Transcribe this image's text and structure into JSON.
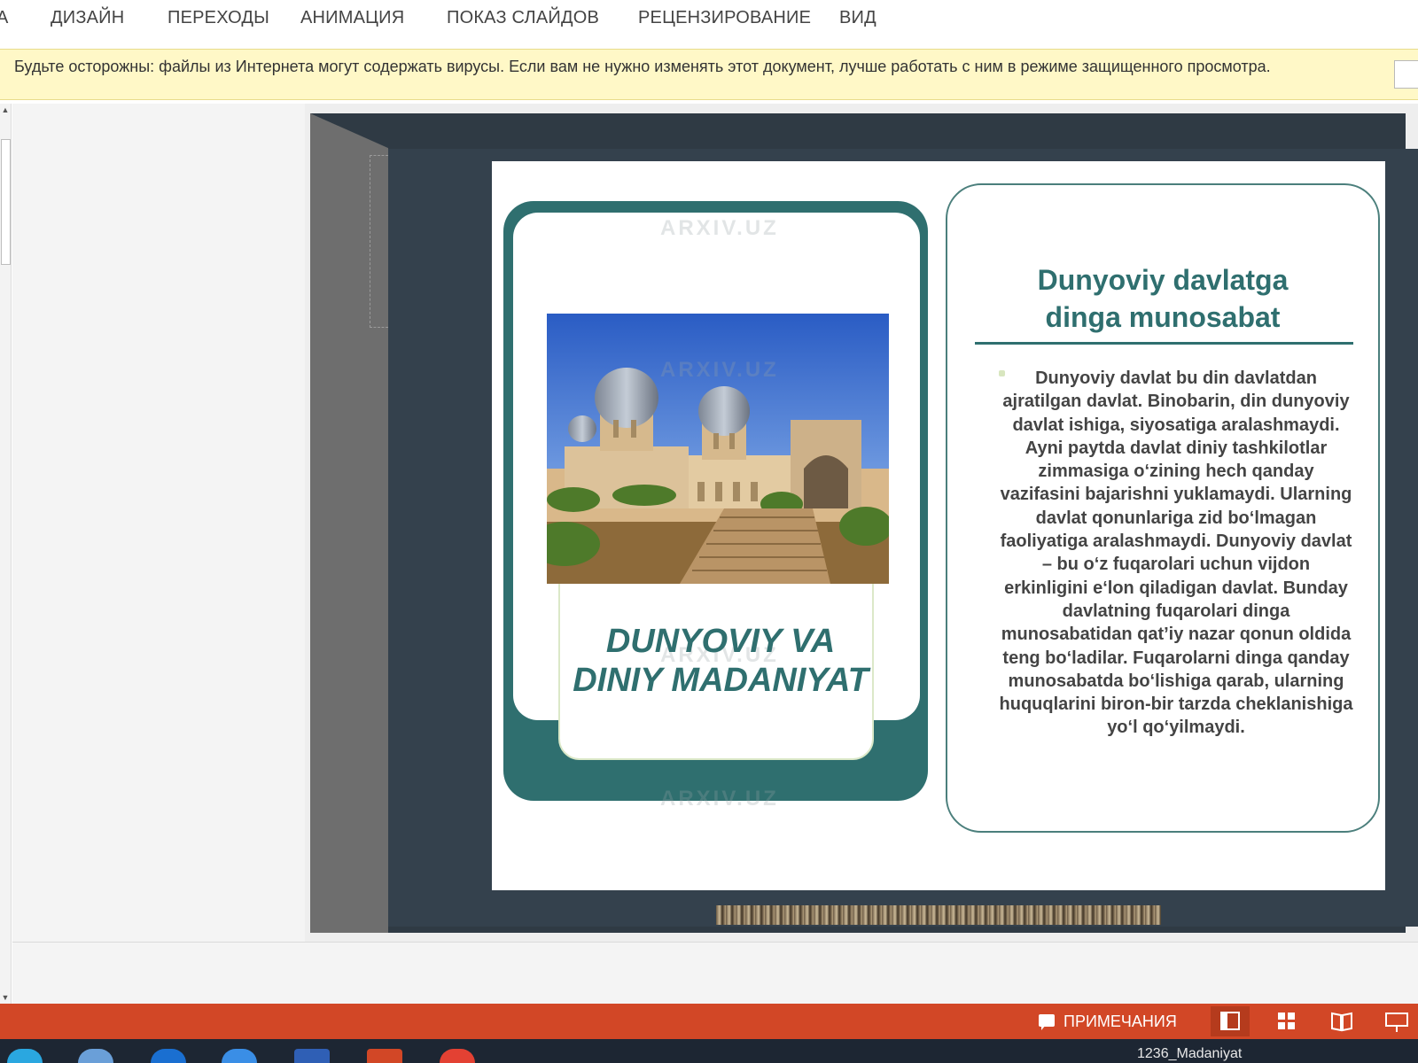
{
  "ribbon": {
    "tabs": [
      {
        "label": "А"
      },
      {
        "label": "ДИЗАЙН"
      },
      {
        "label": "ПЕРЕХОДЫ"
      },
      {
        "label": "АНИМАЦИЯ"
      },
      {
        "label": "ПОКАЗ СЛАЙДОВ"
      },
      {
        "label": "РЕЦЕНЗИРОВАНИЕ"
      },
      {
        "label": "ВИД"
      }
    ]
  },
  "protected_view": {
    "message": "Будьте осторожны: файлы из Интернета могут содержать вирусы. Если вам не нужно изменять этот документ, лучше работать с ним в режиме защищенного просмотра."
  },
  "slide": {
    "watermark": "ARXIV.UZ",
    "left_title_line1": "DUNYOVIY VA",
    "left_title_line2": "DINIY MADANIYAT",
    "right_title_line1": "Dunyoviy davlatga",
    "right_title_line2": "dinga munosabat",
    "right_body": "Dunyoviy davlat bu din davlatdan ajratilgan davlat. Binobarin, din dunyoviy davlat ishiga, siyosatiga aralashmaydi. Ayni paytda davlat diniy tashkilotlar zimmasiga o‘zining hech qanday vazifasini bajarishni yuklamaydi. Ularning davlat qonunlariga zid bo‘lmagan faoliyatiga aralashmaydi. Dunyoviy davlat – bu o‘z fuqarolari uchun vijdon erkinligini e‘lon qiladigan davlat. Bunday davlatning fuqarolari dinga munosabatidan qat’iy nazar qonun oldida teng bo‘ladilar. Fuqarolarni dinga qanday munosabatda bo‘lishiga qarab, ularning huquqlarini biron-bir tarzda cheklanishiga yo‘l qo‘yilmaydi."
  },
  "status_bar": {
    "notes_label": "ПРИМЕЧАНИЯ",
    "color": "#d24726",
    "view_buttons": [
      "normal-view-icon",
      "slide-sorter-icon",
      "reading-view-icon",
      "slideshow-icon"
    ]
  },
  "taskbar": {
    "window_title": "1236_Madaniyat"
  },
  "colors": {
    "accent_teal": "#2f6f6f",
    "warning_bg": "#fff8c7",
    "slide_bg": "#34414d"
  }
}
